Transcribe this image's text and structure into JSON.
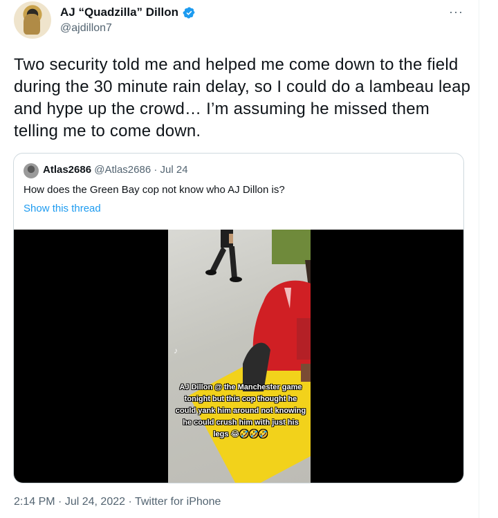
{
  "author": {
    "name": "AJ “Quadzilla” Dillon",
    "handle": "@ajdillon7",
    "verified_icon": "verified-badge-icon",
    "more_label": "···"
  },
  "tweet": {
    "text": "Two security told me and helped me come down to the field during the 30 minute rain delay, so I could do a lambeau leap and hype up the crowd… I’m assuming he missed them telling me to come down."
  },
  "quoted": {
    "name": "Atlas2686",
    "handle": "@Atlas2686",
    "separator": "·",
    "date": "Jul 24",
    "text": "How does the Green Bay cop not know who AJ Dillon is?",
    "show_thread": "Show this thread",
    "media": {
      "watermark": "♪",
      "caption": "AJ Dillon @ the Manchester game tonight but this cop thought he could yank him around not knowing he could crush him with just his legs 😂🤣🤣🤣"
    }
  },
  "footer": {
    "time": "2:14 PM",
    "date": "Jul 24, 2022",
    "source": "Twitter for iPhone",
    "separator": "·"
  },
  "colors": {
    "text": "#0f1419",
    "secondary": "#536471",
    "link": "#1d9bf0",
    "border": "#cfd9de"
  }
}
